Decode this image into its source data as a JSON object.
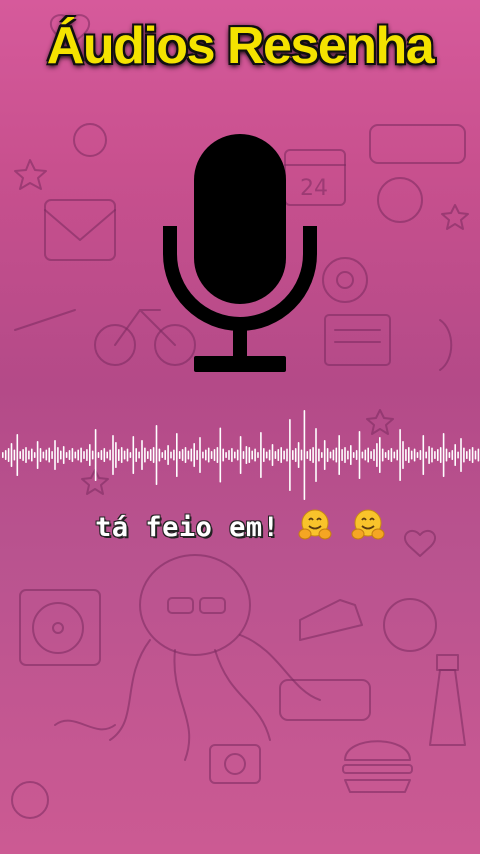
{
  "header": {
    "title": "Áudios Resenha"
  },
  "caption": {
    "text": "tá feio em!",
    "emoji_icons": [
      "hugging-face-icon",
      "hugging-face-icon"
    ]
  },
  "visuals": {
    "background_colors": [
      "#d65a9b",
      "#b44a88",
      "#cc5a93"
    ],
    "title_color": "#f4e300",
    "mic_icon": "microphone-icon",
    "waveform_color": "#ffffff"
  }
}
